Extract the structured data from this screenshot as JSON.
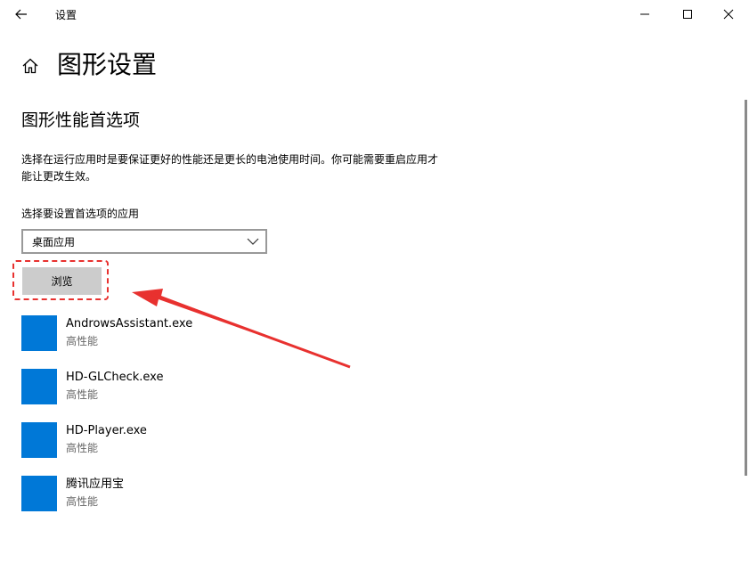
{
  "window": {
    "title": "设置",
    "back_icon": "arrow-left-icon",
    "minimize_icon": "minimize-icon",
    "maximize_icon": "maximize-icon",
    "close_icon": "close-icon"
  },
  "header": {
    "home_icon": "home-icon",
    "page_title": "图形设置"
  },
  "section": {
    "title": "图形性能首选项",
    "description": "选择在运行应用时是要保证更好的性能还是更长的电池使用时间。你可能需要重启应用才能让更改生效。",
    "select_label": "选择要设置首选项的应用",
    "dropdown_value": "桌面应用",
    "browse_label": "浏览"
  },
  "apps": [
    {
      "name": "AndrowsAssistant.exe",
      "preference": "高性能"
    },
    {
      "name": "HD-GLCheck.exe",
      "preference": "高性能"
    },
    {
      "name": "HD-Player.exe",
      "preference": "高性能"
    },
    {
      "name": "腾讯应用宝",
      "preference": "高性能"
    }
  ],
  "colors": {
    "accent": "#0078d7",
    "annotation_red": "#e8312f",
    "button_gray": "#cccccc"
  }
}
